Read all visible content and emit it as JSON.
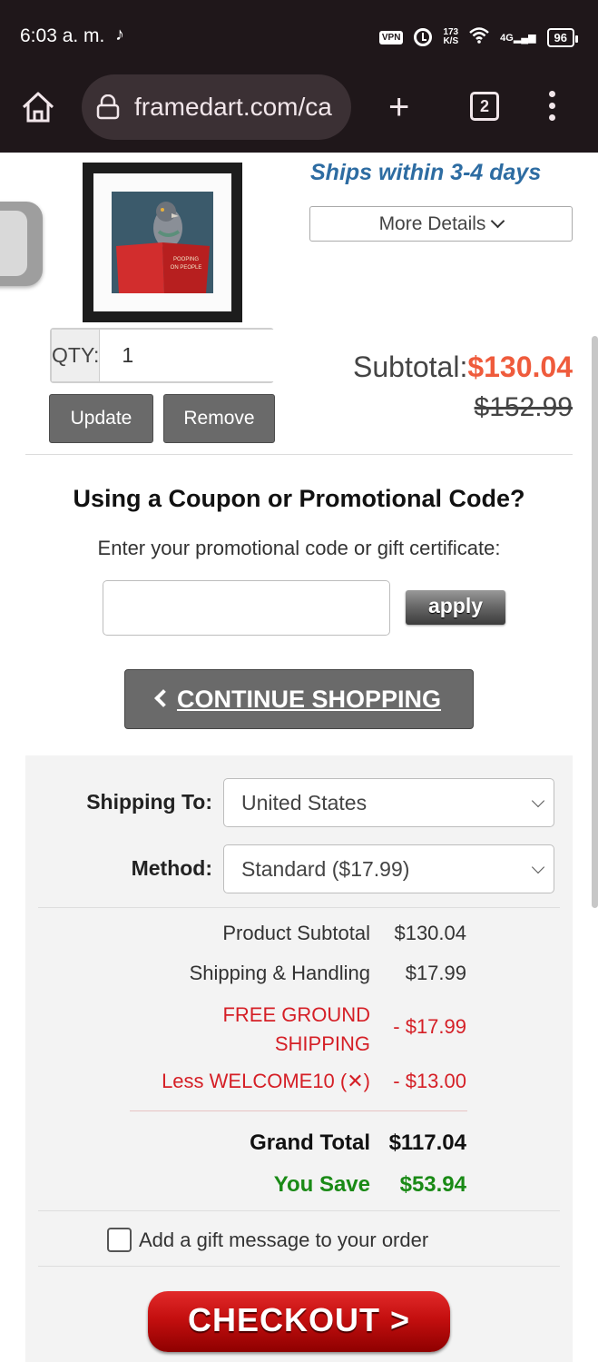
{
  "status_bar": {
    "time": "6:03 a. m.",
    "vpn": "VPN",
    "speed_value": "173",
    "speed_unit": "K/S",
    "network": "4G",
    "battery": "96"
  },
  "browser": {
    "url": "framedart.com/ca",
    "tab_count": "2"
  },
  "product": {
    "shipping_note": "Ships within 3-4 days",
    "more_details_label": "More Details",
    "art_text": "POOPING ON PEOPLE",
    "qty_label": "QTY:",
    "qty_value": "1",
    "update_label": "Update",
    "remove_label": "Remove",
    "subtotal_label": "Subtotal:",
    "subtotal_price": "$130.04",
    "original_price": "$152.99"
  },
  "coupon": {
    "title": "Using a Coupon or Promotional Code?",
    "subtitle": "Enter your promotional code or gift certificate:",
    "input_value": "",
    "apply_label": "apply"
  },
  "continue_shopping_label": "CONTINUE SHOPPING",
  "shipping": {
    "to_label": "Shipping To:",
    "to_value": "United States",
    "method_label": "Method:",
    "method_value": "Standard ($17.99)"
  },
  "summary": {
    "product_subtotal_label": "Product Subtotal",
    "product_subtotal_value": "$130.04",
    "shipping_label": "Shipping & Handling",
    "shipping_value": "$17.99",
    "free_shipping_line1": "FREE GROUND",
    "free_shipping_line2": "SHIPPING",
    "free_shipping_value": "- $17.99",
    "coupon_label": "Less WELCOME10 (",
    "coupon_label_end": ")",
    "coupon_value": "- $13.00",
    "grand_total_label": "Grand Total",
    "grand_total_value": "$117.04",
    "you_save_label": "You Save",
    "you_save_value": "$53.94",
    "gift_message_label": "Add a gift message to your order",
    "checkout_label": "CHECKOUT >"
  },
  "colors": {
    "accent_red": "#ef5b3c",
    "ship_blue": "#2d6ca2",
    "discount_red": "#d51f26",
    "save_green": "#1a8a16"
  }
}
